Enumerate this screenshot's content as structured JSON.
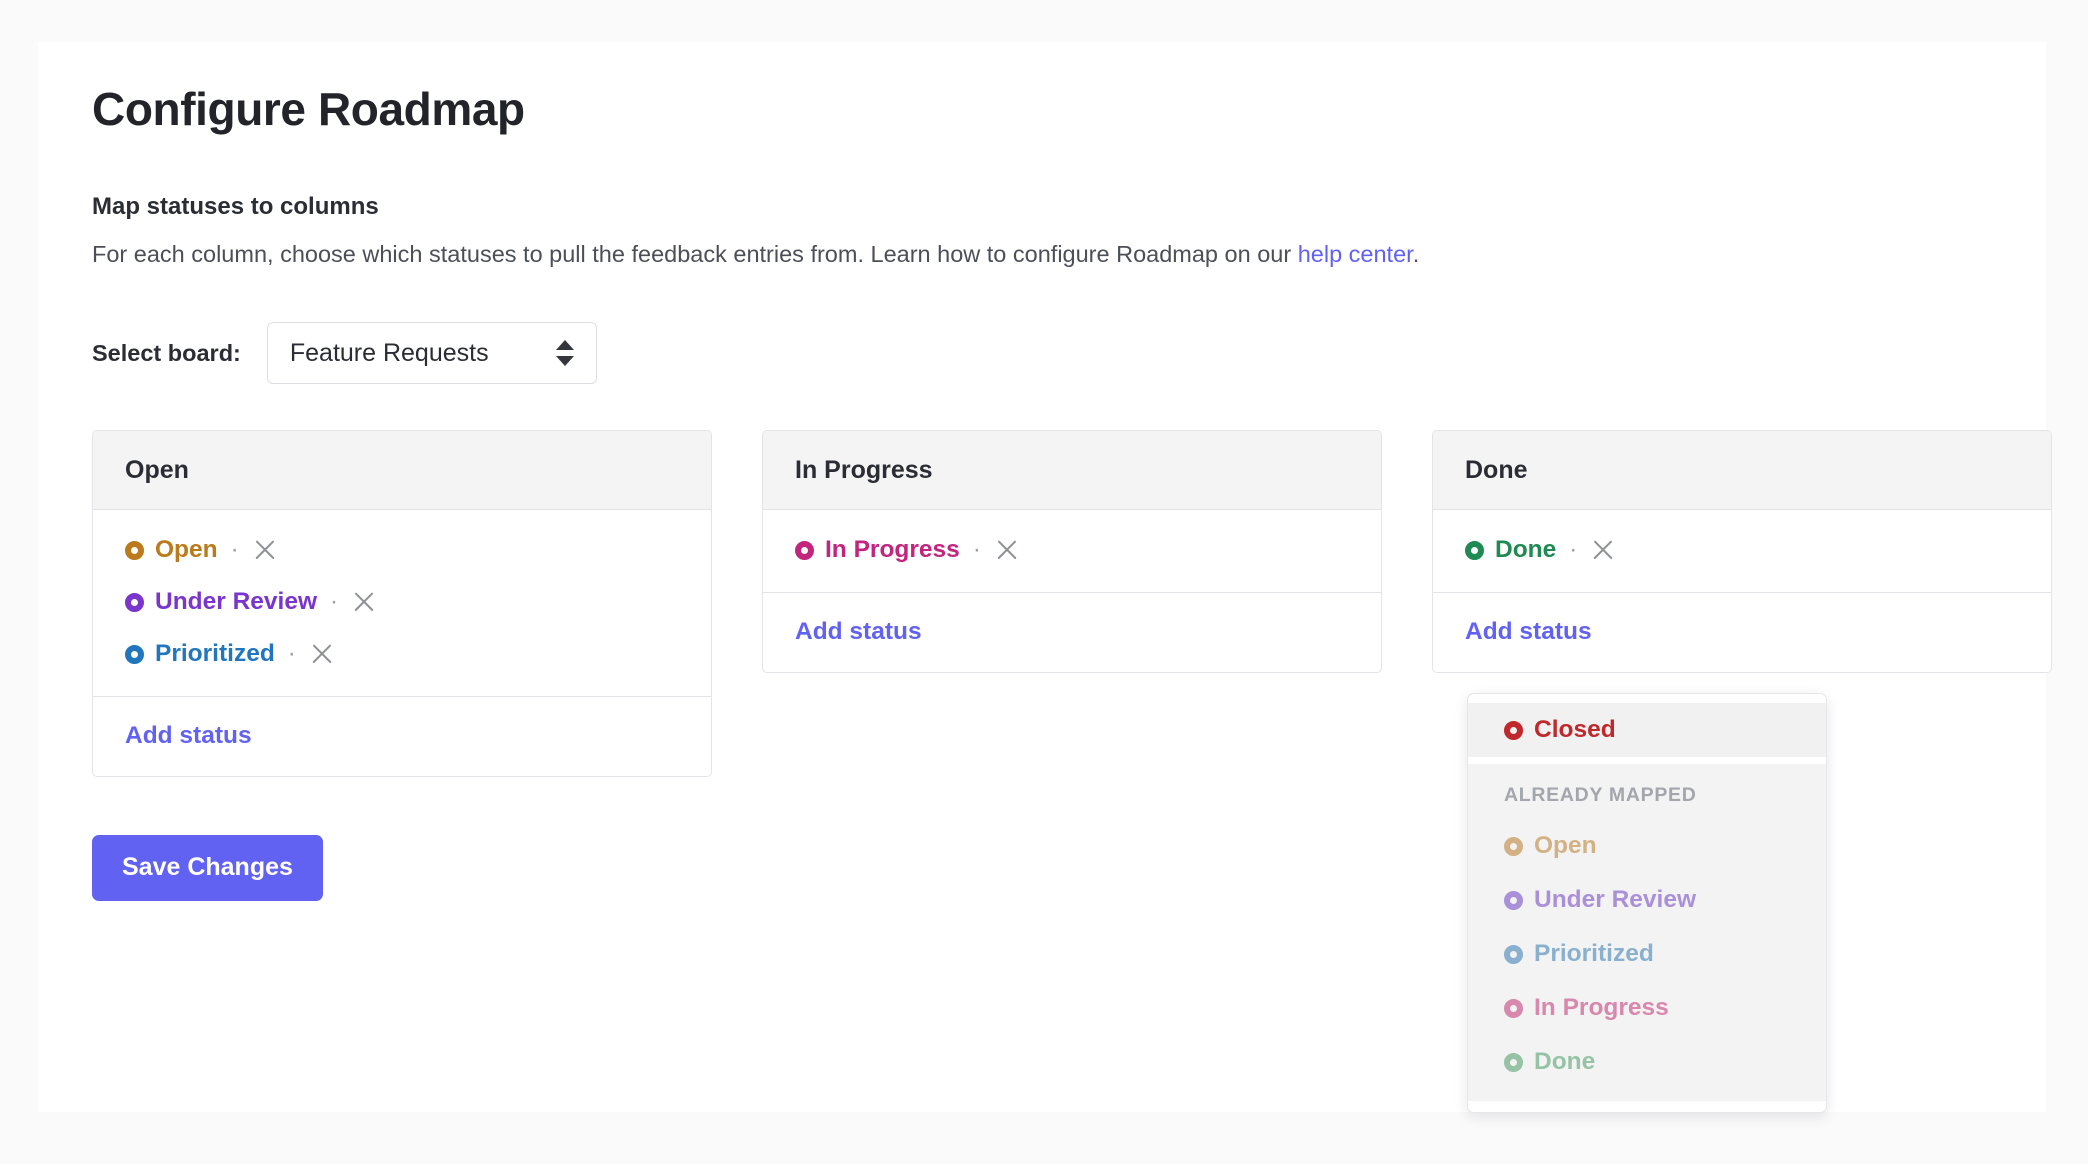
{
  "page": {
    "title": "Configure Roadmap",
    "background_color": "#fafafa",
    "card_background": "#ffffff"
  },
  "section": {
    "heading": "Map statuses to columns",
    "description_before": "For each column, choose which statuses to pull the feedback entries from. Learn how to configure Roadmap on our ",
    "link_text": "help center",
    "description_after": "."
  },
  "board_selector": {
    "label": "Select board:",
    "selected": "Feature Requests",
    "arrow_icon": "select-updown-arrows"
  },
  "columns": [
    {
      "title": "Open",
      "statuses": [
        {
          "label": "Open",
          "color": "#bb7a1c"
        },
        {
          "label": "Under Review",
          "color": "#7a35cc"
        },
        {
          "label": "Prioritized",
          "color": "#2176bd"
        }
      ],
      "add_label": "Add status",
      "separator": "·"
    },
    {
      "title": "In Progress",
      "statuses": [
        {
          "label": "In Progress",
          "color": "#c2247e"
        }
      ],
      "add_label": "Add status",
      "separator": "·"
    },
    {
      "title": "Done",
      "statuses": [
        {
          "label": "Done",
          "color": "#1f8a52"
        }
      ],
      "add_label": "Add status",
      "separator": "·"
    }
  ],
  "dropdown": {
    "available": [
      {
        "label": "Closed",
        "color": "#c0282b"
      }
    ],
    "group_title": "ALREADY MAPPED",
    "mapped": [
      {
        "label": "Open",
        "color": "#d4b184"
      },
      {
        "label": "Under Review",
        "color": "#a990d8"
      },
      {
        "label": "Prioritized",
        "color": "#8ab0cf"
      },
      {
        "label": "In Progress",
        "color": "#d888ac"
      },
      {
        "label": "Done",
        "color": "#96c3a6"
      }
    ]
  },
  "actions": {
    "save_label": "Save Changes",
    "save_color": "#6161f2"
  }
}
